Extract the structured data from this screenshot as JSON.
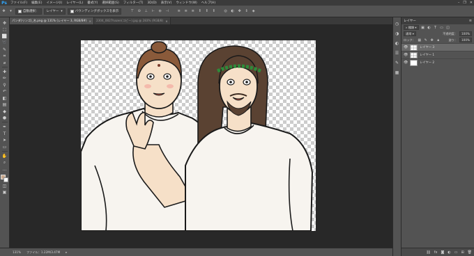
{
  "app": {
    "logo": "Ps"
  },
  "menu": {
    "items": [
      "ファイル(F)",
      "編集(E)",
      "イメージ(I)",
      "レイヤー(L)",
      "書式(Y)",
      "選択範囲(S)",
      "フィルター(T)",
      "3D(D)",
      "表示(V)",
      "ウィンドウ(W)",
      "ヘルプ(H)"
    ]
  },
  "window_controls": {
    "minimize": "–",
    "restore": "❐",
    "close": "✕"
  },
  "options_bar": {
    "auto_select_label": "自動選択：",
    "auto_select_target": "レイヤー",
    "transform_controls_label": "バウンディングボックスを表示"
  },
  "tabs": [
    {
      "label": "パンダ(リンゴ)_名.png @ 131% (レイヤー 3, RGB/8#)",
      "close": "×",
      "active": true
    },
    {
      "label": "2304_0827hazen(コピー).jpg @ 283% (RGB/8)",
      "close": "×",
      "active": false
    }
  ],
  "tools": [
    {
      "name": "move-tool-icon",
      "glyph": "✥"
    },
    {
      "name": "artboard-tool-icon",
      "glyph": "⬚"
    },
    {
      "name": "marquee-tool-icon",
      "glyph": "⬜"
    },
    {
      "name": "lasso-tool-icon",
      "glyph": "➰"
    },
    {
      "name": "quick-select-tool-icon",
      "glyph": "✎"
    },
    {
      "name": "crop-tool-icon",
      "glyph": "⌗"
    },
    {
      "name": "eyedropper-tool-icon",
      "glyph": "⌀"
    },
    {
      "name": "healing-brush-tool-icon",
      "glyph": "✚"
    },
    {
      "name": "brush-tool-icon",
      "glyph": "✏"
    },
    {
      "name": "clone-stamp-tool-icon",
      "glyph": "⚲"
    },
    {
      "name": "history-brush-tool-icon",
      "glyph": "↶"
    },
    {
      "name": "eraser-tool-icon",
      "glyph": "◧"
    },
    {
      "name": "gradient-tool-icon",
      "glyph": "▤"
    },
    {
      "name": "blur-tool-icon",
      "glyph": "◆"
    },
    {
      "name": "dodge-tool-icon",
      "glyph": "●"
    },
    {
      "name": "pen-tool-icon",
      "glyph": "✒"
    },
    {
      "name": "type-tool-icon",
      "glyph": "T"
    },
    {
      "name": "path-select-tool-icon",
      "glyph": "➤"
    },
    {
      "name": "rectangle-tool-icon",
      "glyph": "▭"
    },
    {
      "name": "hand-tool-icon",
      "glyph": "✋"
    },
    {
      "name": "zoom-tool-icon",
      "glyph": "⌕"
    },
    {
      "name": "more-tools-icon",
      "glyph": "…"
    }
  ],
  "colors": {
    "foreground": "#c9a88c",
    "background": "#ffffff",
    "accent": "#31a8ff",
    "laurel": "#2e8b3a",
    "hair_left": "#8a5a3a",
    "hair_right": "#5a4232",
    "skin": "#f6e0c8"
  },
  "dock_icons": [
    "history-icon",
    "color-icon",
    "adjustments-icon",
    "properties-icon",
    "paths-icon",
    "channels-icon"
  ],
  "status": {
    "zoom": "131%",
    "doc_info": "ファイル：1.22M/3.47M"
  },
  "layers_panel": {
    "title": "レイヤー",
    "menu_glyph": "≡",
    "kind_label": "種類",
    "blend_mode": "通常",
    "opacity_label": "不透明度：",
    "opacity_value": "100%",
    "lock_label": "ロック：",
    "fill_label": "塗り：",
    "fill_value": "100%",
    "layers": [
      {
        "name": "レイヤー 3",
        "selected": true,
        "visible": true,
        "thumb": "checker"
      },
      {
        "name": "レイヤー 1",
        "selected": false,
        "visible": true,
        "thumb": "checker"
      },
      {
        "name": "レイヤー 2",
        "selected": false,
        "visible": true,
        "thumb": "white"
      }
    ]
  }
}
